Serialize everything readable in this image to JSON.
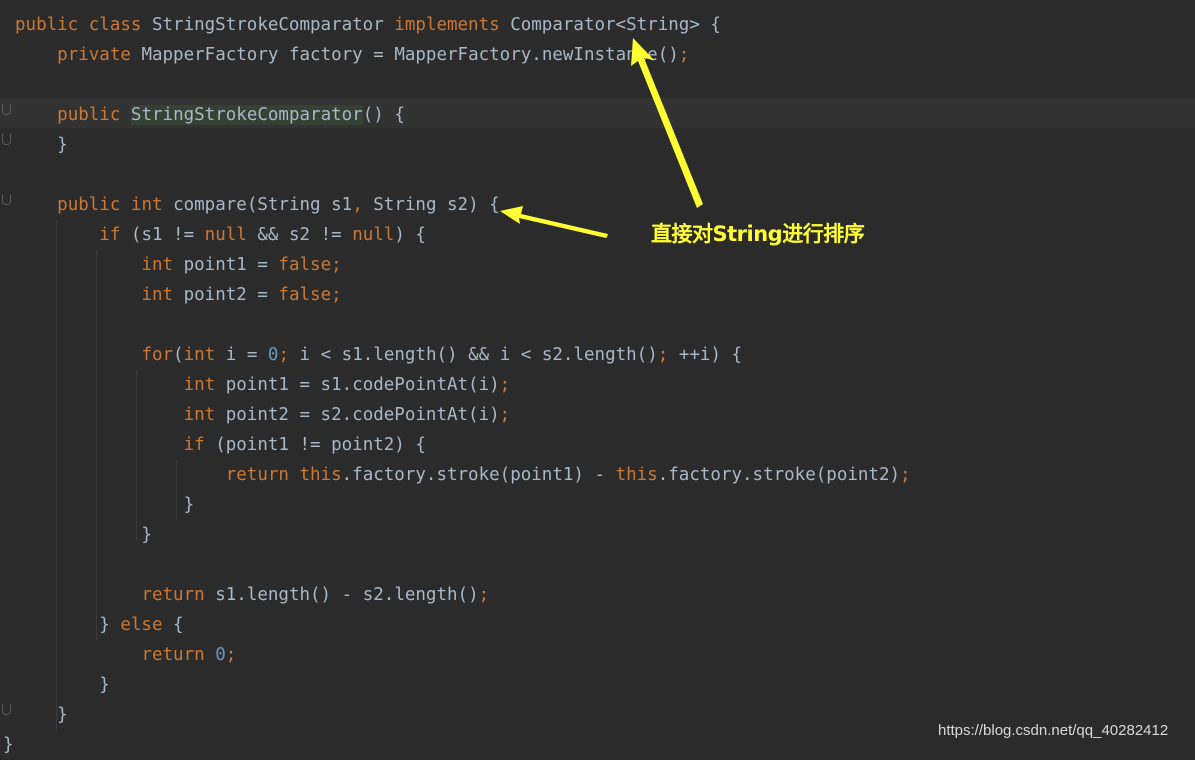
{
  "code_lines": [
    "public class StringStrokeComparator implements Comparator<String> {",
    "    private MapperFactory factory = MapperFactory.newInstance();",
    "",
    "    public StringStrokeComparator() {",
    "    }",
    "",
    "    public int compare(String s1, String s2) {",
    "        if (s1 != null && s2 != null) {",
    "            int point1 = false;",
    "            int point2 = false;",
    "",
    "            for(int i = 0; i < s1.length() && i < s2.length(); ++i) {",
    "                int point1 = s1.codePointAt(i);",
    "                int point2 = s2.codePointAt(i);",
    "                if (point1 != point2) {",
    "                    return this.factory.stroke(point1) - this.factory.stroke(point2);",
    "                }",
    "            }",
    "",
    "            return s1.length() - s2.length();",
    "        } else {",
    "            return 0;",
    "        }",
    "    }",
    "}"
  ],
  "annotation": {
    "label": "直接对String进行排序",
    "color": "#ffff33"
  },
  "watermark": "https://blog.csdn.net/qq_40282412",
  "colors": {
    "background": "#2b2b2b",
    "keyword": "#cc7832",
    "identifier": "#a9b7c6",
    "number": "#6897bb"
  }
}
